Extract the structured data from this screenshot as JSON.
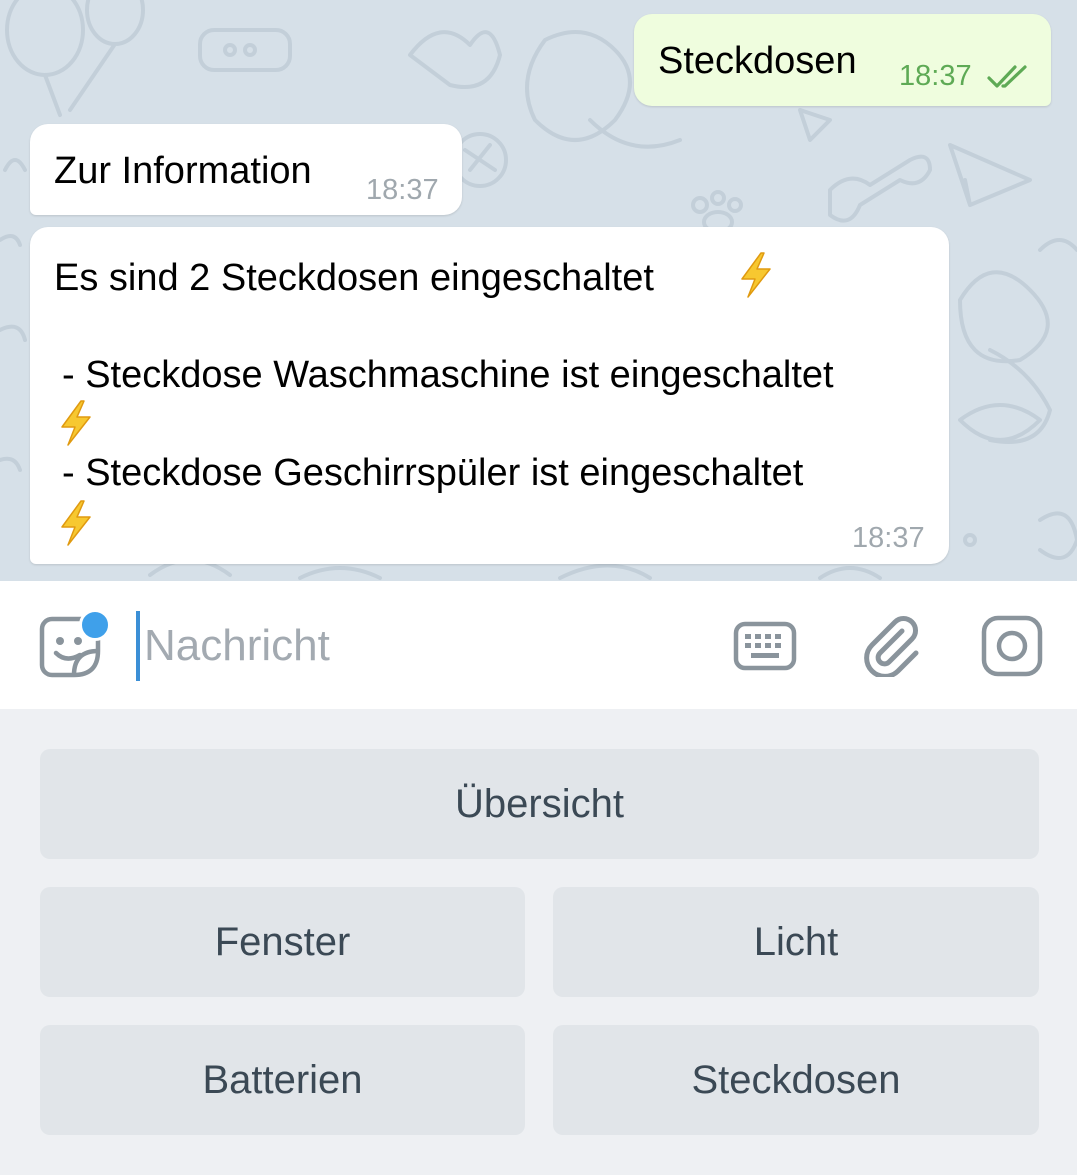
{
  "messages": {
    "sent": {
      "text": "Steckdosen",
      "time": "18:37",
      "status_icon": "double-check-icon"
    },
    "info": {
      "text": "Zur Information",
      "time": "18:37"
    },
    "status": {
      "line1": "Es sind  2 Steckdosen eingeschaltet",
      "line2": "- Steckdose Waschmaschine ist eingeschaltet",
      "line3": "- Steckdose Geschirrspüler ist eingeschaltet",
      "emoji_icon": "lightning-bolt-icon",
      "time": "18:37"
    }
  },
  "input": {
    "placeholder": "Nachricht",
    "value": ""
  },
  "keyboard": {
    "row1": [
      "Übersicht"
    ],
    "row2": [
      "Fenster",
      "Licht"
    ],
    "row3": [
      "Batterien",
      "Steckdosen"
    ]
  },
  "colors": {
    "chat_background": "#d6e0e8",
    "outgoing_bubble": "#effdde",
    "incoming_bubble": "#ffffff",
    "accent": "#3fa0ea",
    "read_check": "#5eaa55",
    "keyboard_button": "#e1e5e9"
  },
  "icons": [
    "sticker-icon",
    "keyboard-icon",
    "paperclip-icon",
    "camera-icon"
  ]
}
